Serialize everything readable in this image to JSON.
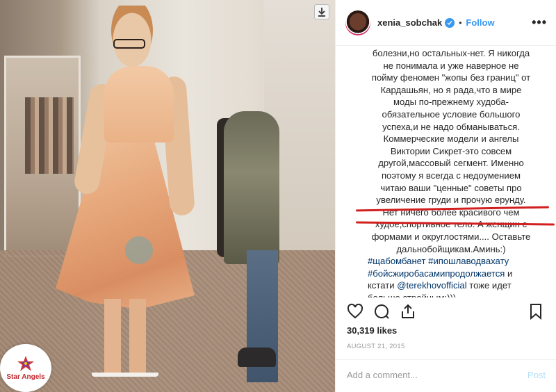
{
  "photo": {
    "download_icon": "download-icon"
  },
  "watermark": {
    "label": "Star Angels",
    "icon": "star-icon"
  },
  "post": {
    "username": "xenia_sobchak",
    "verified_icon": "verified-badge-icon",
    "follow_label": "Follow",
    "more_icon": "more-options-icon",
    "caption_lines": [
      "болезни,но остальных-нет. Я никогда",
      "не понимала и уже наверное не",
      "пойму феномен \"жопы без границ\" от",
      "Кардашьян, но я рада,что в мире",
      "моды по-прежнему худоба-",
      "обязательное условие большого",
      "успеха,и не надо обманываться.",
      "Коммерческие модели и ангелы",
      "Виктории Сикрет-это совсем",
      "другой,массовый сегмент. Именно",
      "поэтому я всегда с недоумением",
      "читаю ваши \"ценные\" советы про",
      "увеличение груди и прочую ерунду.",
      "Нет ничего более красивого чем",
      "худое,спортивное тело. А женщин с",
      "формами и округлостями.... Оставьте",
      "дальнобойщикам.Аминь:)"
    ],
    "hashtag1": "#щабомбанет",
    "hashtag2": "#ипошлаводвахату",
    "hashtag3": "#бойсжиробасамипродолжается",
    "text_and": " и",
    "text_kstati": "кстати ",
    "mention": "@terekhovofficial",
    "text_after_mention": " тоже идет",
    "last_line": "больше стройным:)))",
    "likes": "30,319 likes",
    "date": "AUGUST 21, 2015",
    "comment_placeholder": "Add a comment...",
    "post_label": "Post",
    "accent_color": "#3897f0",
    "highlight_color": "#d21f1f"
  },
  "actions": {
    "like_icon": "heart-icon",
    "comment_icon": "comment-icon",
    "share_icon": "share-icon",
    "save_icon": "bookmark-icon"
  }
}
